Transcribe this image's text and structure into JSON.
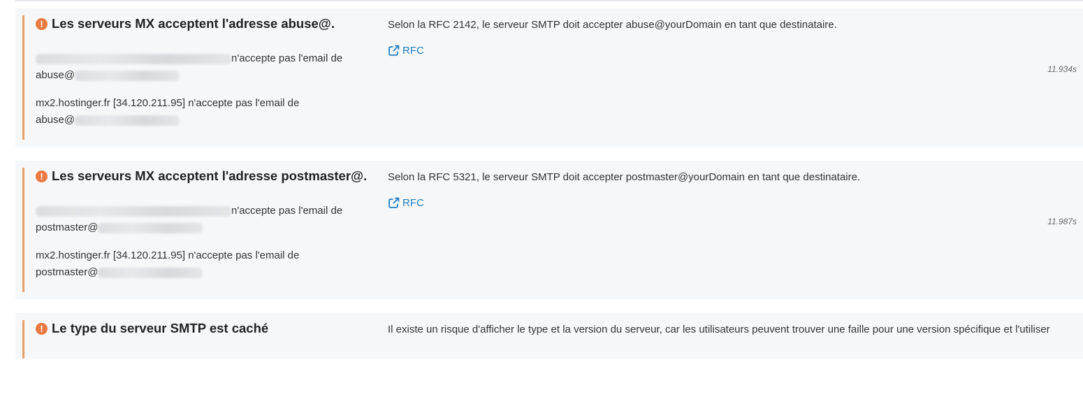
{
  "results": [
    {
      "title": "Les serveurs MX acceptent l'adresse abuse@.",
      "description": "Selon la RFC 2142, le serveur SMTP doit accepter abuse@yourDomain en tant que destinataire.",
      "link_label": "RFC",
      "timing": "11.934s",
      "lines": [
        {
          "prefix": "",
          "suffix": "n'accepte pas l'email de",
          "recipient": "abuse@"
        },
        {
          "prefix": "mx2.hostinger.fr [34.120.211.95]",
          "suffix": " n'accepte pas l'email de",
          "recipient": "abuse@"
        }
      ]
    },
    {
      "title": "Les serveurs MX acceptent l'adresse postmaster@.",
      "description": "Selon la RFC 5321, le serveur SMTP doit accepter postmaster@yourDomain en tant que destinataire.",
      "link_label": "RFC",
      "timing": "11.987s",
      "lines": [
        {
          "prefix": "",
          "suffix": "n'accepte pas l'email de",
          "recipient": "postmaster@"
        },
        {
          "prefix": "mx2.hostinger.fr [34.120.211.95]",
          "suffix": " n'accepte pas l'email de",
          "recipient": "postmaster@"
        }
      ]
    },
    {
      "title": "Le type du serveur SMTP est caché",
      "description": "Il existe un risque d'afficher le type et la version du serveur, car les utilisateurs peuvent trouver une faille pour une version spécifique et l'utiliser"
    }
  ],
  "colors": {
    "accent": "#e8a06a",
    "warning_icon": "#ea7a42",
    "link": "#1f7fc0",
    "row_bg": "#f6f7f9"
  },
  "icons": {
    "warning": "exclamation-circle-icon",
    "external_link": "external-link-icon"
  }
}
